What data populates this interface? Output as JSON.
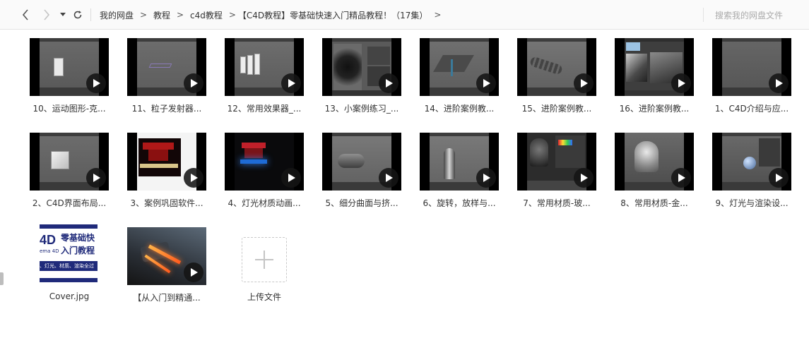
{
  "nav": {
    "back_icon": "chevron-left-icon",
    "forward_icon": "chevron-right-icon",
    "history_icon": "caret-down-icon",
    "refresh_icon": "refresh-icon"
  },
  "breadcrumb": {
    "items": [
      "我的网盘",
      "教程",
      "c4d教程",
      "【C4D教程】零基础快速入门精品教程！（17集）"
    ],
    "separator": ">"
  },
  "search": {
    "placeholder": "搜索我的网盘文件"
  },
  "files": [
    {
      "name": "10、运动图形-克...",
      "type": "video",
      "icon": "play-icon"
    },
    {
      "name": "11、粒子发射器...",
      "type": "video",
      "icon": "play-icon"
    },
    {
      "name": "12、常用效果器_...",
      "type": "video",
      "icon": "play-icon"
    },
    {
      "name": "13、小案例练习_...",
      "type": "video",
      "icon": "play-icon"
    },
    {
      "name": "14、进阶案例教...",
      "type": "video",
      "icon": "play-icon"
    },
    {
      "name": "15、进阶案例教...",
      "type": "video",
      "icon": "play-icon"
    },
    {
      "name": "16、进阶案例教...",
      "type": "video",
      "icon": "play-icon"
    },
    {
      "name": "1、C4D介绍与应...",
      "type": "video",
      "icon": "play-icon"
    },
    {
      "name": "2、C4D界面布局...",
      "type": "video",
      "icon": "play-icon"
    },
    {
      "name": "3、案例巩固软件...",
      "type": "video",
      "icon": "play-icon"
    },
    {
      "name": "4、灯光材质动画...",
      "type": "video",
      "icon": "play-icon"
    },
    {
      "name": "5、细分曲面与挤...",
      "type": "video",
      "icon": "play-icon"
    },
    {
      "name": "6、旋转，放样与...",
      "type": "video",
      "icon": "play-icon"
    },
    {
      "name": "7、常用材质-玻...",
      "type": "video",
      "icon": "play-icon"
    },
    {
      "name": "8、常用材质-金...",
      "type": "video",
      "icon": "play-icon"
    },
    {
      "name": "9、灯光与渲染设...",
      "type": "video",
      "icon": "play-icon"
    },
    {
      "name": "Cover.jpg",
      "type": "image",
      "icon": "image-icon"
    },
    {
      "name": "【从入门到精通...",
      "type": "video",
      "icon": "play-icon"
    }
  ],
  "cover": {
    "left_text": "4D",
    "small_text": "ema 4D",
    "line1": "零基础快",
    "line2": "入门教程",
    "footer": "、灯光、材质、渲染全过"
  },
  "upload": {
    "label": "上传文件",
    "icon": "plus-icon"
  },
  "colors": {
    "topbar_bg": "#fafafa",
    "play_bg": "#141414",
    "cover_blue": "#1f2a7a"
  }
}
